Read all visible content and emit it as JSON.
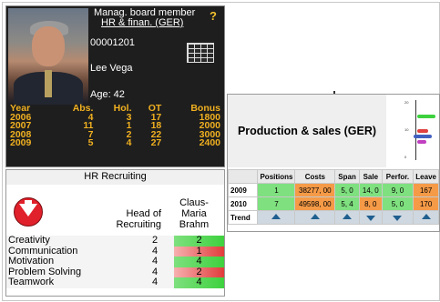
{
  "profile": {
    "title_line1": "Manag. board member",
    "title_line2": "HR & finan. (GER)",
    "id": "00001201",
    "name": "Lee Vega",
    "age": "Age: 42",
    "help_icon": "question-mark-icon",
    "stats": {
      "headers": [
        "Year",
        "Abs.",
        "Hol.",
        "OT",
        "Bonus"
      ],
      "rows": [
        [
          "2006",
          "4",
          "3",
          "17",
          "1800"
        ],
        [
          "2007",
          "11",
          "1",
          "18",
          "2000"
        ],
        [
          "2008",
          "7",
          "2",
          "22",
          "3000"
        ],
        [
          "2009",
          "5",
          "4",
          "27",
          "2400"
        ]
      ]
    }
  },
  "hr": {
    "title": "HR Recruiting",
    "role_line1": "Head of",
    "role_line2": "Recruiting",
    "person_line1": "Claus-",
    "person_line2": "Maria",
    "person_line3": "Brahm",
    "skills": [
      {
        "name": "Creativity",
        "required": "2",
        "actual": "2",
        "status": "good"
      },
      {
        "name": "Communication",
        "required": "4",
        "actual": "1",
        "status": "bad"
      },
      {
        "name": "Motivation",
        "required": "4",
        "actual": "4",
        "status": "good"
      },
      {
        "name": "Problem Solving",
        "required": "4",
        "actual": "2",
        "status": "bad"
      },
      {
        "name": "Teamwork",
        "required": "4",
        "actual": "4",
        "status": "good"
      }
    ]
  },
  "production": {
    "title": "Production & sales (GER)",
    "chart_ticks": [
      "20",
      "10",
      "0"
    ],
    "headers": [
      "",
      "Positions",
      "Costs",
      "Span",
      "Sale",
      "Perfor.",
      "Leave"
    ],
    "rows": [
      {
        "label": "2009",
        "cells": [
          "1",
          "38277, 00",
          "5, 0",
          "14, 0",
          "9, 0",
          "167"
        ]
      },
      {
        "label": "2010",
        "cells": [
          "7",
          "49598, 00",
          "5, 4",
          "8, 0",
          "5, 0",
          "170"
        ]
      }
    ],
    "trend_label": "Trend",
    "trend": [
      "up",
      "up",
      "up",
      "down",
      "down",
      "up"
    ],
    "colors": {
      "green": "#7fe07f",
      "orange": "#f59a47",
      "blue_header": "#cfd8e0"
    }
  }
}
